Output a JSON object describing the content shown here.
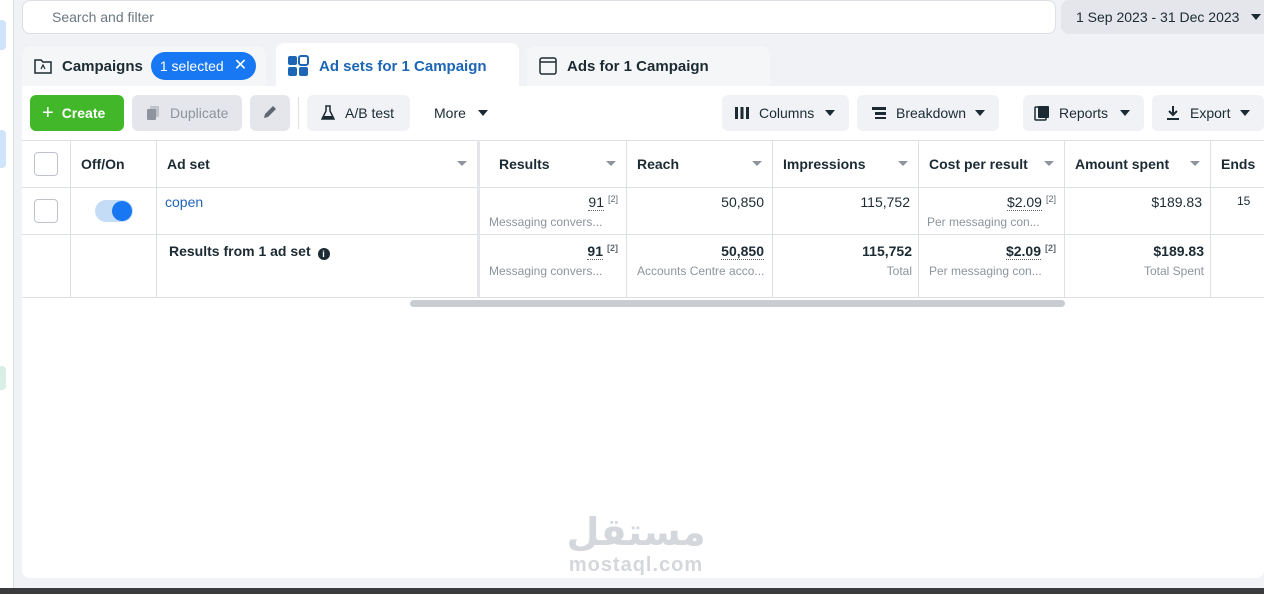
{
  "search": {
    "placeholder": "Search and filter"
  },
  "date_range": {
    "label": "1 Sep 2023 - 31 Dec 2023"
  },
  "tabs": {
    "campaigns": {
      "label": "Campaigns",
      "selected_badge": "1 selected"
    },
    "adsets": {
      "label": "Ad sets for 1 Campaign"
    },
    "ads": {
      "label": "Ads for 1 Campaign"
    }
  },
  "toolbar": {
    "create": "Create",
    "duplicate": "Duplicate",
    "ab_test": "A/B test",
    "more": "More",
    "columns": "Columns",
    "breakdown": "Breakdown",
    "reports": "Reports",
    "export": "Export"
  },
  "table": {
    "headers": {
      "off_on": "Off/On",
      "ad_set": "Ad set",
      "results": "Results",
      "reach": "Reach",
      "impressions": "Impressions",
      "cost_per_result": "Cost per result",
      "amount_spent": "Amount spent",
      "ends": "Ends"
    },
    "row": {
      "name": "copen",
      "toggle_on": true,
      "results": "91",
      "results_note": "[2]",
      "results_sub": "Messaging convers...",
      "reach": "50,850",
      "impressions": "115,752",
      "cost_per_result": "$2.09",
      "cost_note": "[2]",
      "cost_sub": "Per messaging con...",
      "amount_spent": "$189.83",
      "ends": "15"
    },
    "summary": {
      "label": "Results from 1 ad set",
      "results": "91",
      "results_note": "[2]",
      "results_sub": "Messaging convers...",
      "reach": "50,850",
      "reach_sub": "Accounts Centre acco...",
      "impressions": "115,752",
      "impressions_sub": "Total",
      "cost_per_result": "$2.09",
      "cost_note": "[2]",
      "cost_sub": "Per messaging con...",
      "amount_spent": "$189.83",
      "amount_sub": "Total Spent"
    }
  },
  "watermark": {
    "arabic": "مستقل",
    "latin": "mostaql.com"
  },
  "colors": {
    "accent": "#1877f2",
    "create_green": "#42b72a",
    "active_tab_text": "#1d65b5"
  }
}
